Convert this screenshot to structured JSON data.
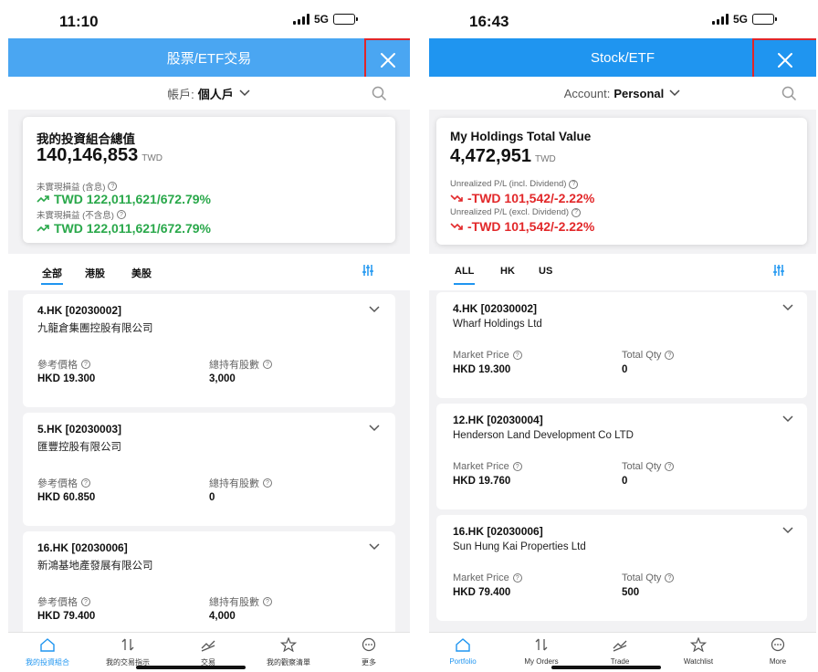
{
  "colors": {
    "header_left": "#4aa6f2",
    "header_right": "#1f95f0",
    "gain": "#29a84a",
    "loss": "#e2282a",
    "highlight_box": "#e0262a"
  },
  "left": {
    "status": {
      "time": "11:10",
      "network": "5G"
    },
    "header": {
      "title": "股票/ETF交易"
    },
    "account": {
      "label": "帳戶:",
      "value": "個人戶"
    },
    "summary": {
      "title": "我的投資組合總值",
      "value": "140,146,853",
      "currency": "TWD",
      "pl1_label": "未實現損益 (含息)",
      "pl1_value": "TWD 122,011,621/672.79%",
      "pl2_label": "未實現損益 (不含息)",
      "pl2_value": "TWD 122,011,621/672.79%"
    },
    "tabs": [
      "全部",
      "港股",
      "美股"
    ],
    "price_label": "參考價格",
    "qty_label": "總持有股數",
    "holdings": [
      {
        "code": "4.HK [02030002]",
        "name": "九龍倉集團控股有限公司",
        "price": "HKD 19.300",
        "qty": "3,000"
      },
      {
        "code": "5.HK [02030003]",
        "name": "匯豐控股有限公司",
        "price": "HKD 60.850",
        "qty": "0"
      },
      {
        "code": "16.HK [02030006]",
        "name": "新鴻基地產發展有限公司",
        "price": "HKD 79.400",
        "qty": "4,000"
      }
    ],
    "nav": [
      "我的投資組合",
      "我的交易指示",
      "交易",
      "我的觀察清單",
      "更多"
    ]
  },
  "right": {
    "status": {
      "time": "16:43",
      "network": "5G"
    },
    "header": {
      "title": "Stock/ETF"
    },
    "account": {
      "label": "Account:",
      "value": "Personal"
    },
    "summary": {
      "title": "My Holdings Total Value",
      "value": "4,472,951",
      "currency": "TWD",
      "pl1_label": "Unrealized P/L (incl. Dividend)",
      "pl1_value": "-TWD 101,542/-2.22%",
      "pl2_label": "Unrealized P/L (excl. Dividend)",
      "pl2_value": "-TWD 101,542/-2.22%"
    },
    "tabs": [
      "ALL",
      "HK",
      "US"
    ],
    "price_label": "Market Price",
    "qty_label": "Total Qty",
    "holdings": [
      {
        "code": "4.HK [02030002]",
        "name": "Wharf Holdings Ltd",
        "price": "HKD 19.300",
        "qty": "0"
      },
      {
        "code": "12.HK [02030004]",
        "name": "Henderson Land Development Co LTD",
        "price": "HKD 19.760",
        "qty": "0"
      },
      {
        "code": "16.HK [02030006]",
        "name": "Sun Hung Kai Properties Ltd",
        "price": "HKD 79.400",
        "qty": "500"
      }
    ],
    "nav": [
      "Portfolio",
      "My Orders",
      "Trade",
      "Watchlist",
      "More"
    ]
  }
}
